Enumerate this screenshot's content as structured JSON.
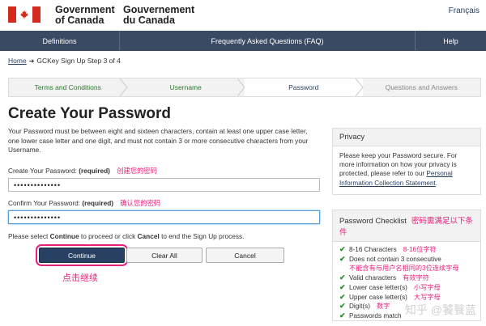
{
  "header": {
    "gov_en_line1": "Government",
    "gov_en_line2": "of Canada",
    "gov_fr_line1": "Gouvernement",
    "gov_fr_line2": "du Canada",
    "lang_link": "Français"
  },
  "nav": {
    "items": [
      "Definitions",
      "Frequently Asked Questions (FAQ)",
      "Help"
    ]
  },
  "breadcrumb": {
    "home": "Home",
    "current": "GCKey Sign Up Step 3 of 4"
  },
  "steps": [
    {
      "label": "Terms and Conditions",
      "state": "done"
    },
    {
      "label": "Username",
      "state": "done"
    },
    {
      "label": "Password",
      "state": "active"
    },
    {
      "label": "Questions and Answers",
      "state": "future"
    }
  ],
  "main": {
    "title": "Create Your Password",
    "intro": "Your Password must be between eight and sixteen characters, contain at least one upper case letter, one lower case letter and one digit, and must not contain 3 or more consecutive characters from your Username.",
    "create_label": "Create Your Password:",
    "create_required": "(required)",
    "create_annot": "创建您的密码",
    "create_value": "••••••••••••••",
    "confirm_label": "Confirm Your Password:",
    "confirm_required": "(required)",
    "confirm_annot": "确认您的密码",
    "confirm_value": "••••••••••••••",
    "instruction_pre": "Please select ",
    "instruction_continue": "Continue",
    "instruction_mid": " to proceed or click ",
    "instruction_cancel": "Cancel",
    "instruction_post": " to end the Sign Up process.",
    "continue_button": "Continue",
    "clear_button": "Clear All",
    "cancel_button": "Cancel",
    "click_annot": "点击继续"
  },
  "privacy": {
    "title": "Privacy",
    "text": "Please keep your Password secure. For more information on how your privacy is protected, please refer to our ",
    "link": "Personal Information Collection Statement",
    "text_end": "."
  },
  "checklist": {
    "title": "Password Checklist",
    "title_annot": "密码需满足以下条件",
    "items": [
      {
        "text": "8-16 Characters",
        "annot": "8-16位字符"
      },
      {
        "text": "Does not contain 3 consecutive",
        "annot": ""
      },
      {
        "text": "不能含有与用户名相同的3位连续字母",
        "annot": ""
      },
      {
        "text": "Valid characters",
        "annot": "有效字符"
      },
      {
        "text": "Lower case letter(s)",
        "annot": "小写字母"
      },
      {
        "text": "Upper case letter(s)",
        "annot": "大写字母"
      },
      {
        "text": "Digit(s)",
        "annot": "数字"
      },
      {
        "text": "Passwords match",
        "annot": ""
      }
    ]
  },
  "watermark": "知乎 @饕餮蓝"
}
